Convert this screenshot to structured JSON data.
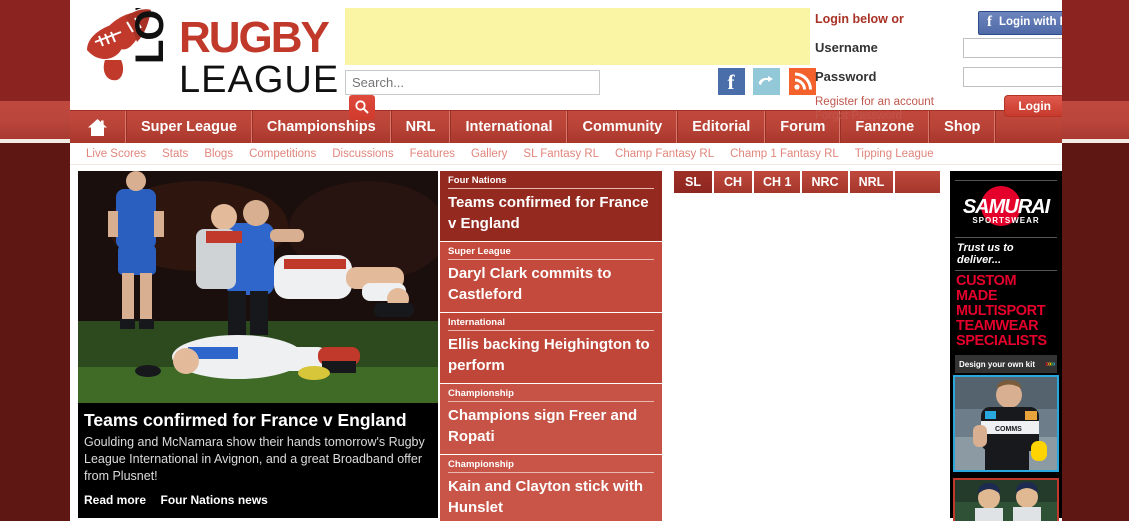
{
  "site": {
    "name": "Love Rugby League",
    "logo_line1": "LOVE",
    "logo_line2": "RUGBY",
    "logo_line3": "LEAGUE"
  },
  "search": {
    "placeholder": "Search...",
    "value": "",
    "icon": "search-icon"
  },
  "social": [
    {
      "name": "facebook-icon",
      "label": "f"
    },
    {
      "name": "twitter-icon",
      "label": "t"
    },
    {
      "name": "rss-icon",
      "label": "rss"
    }
  ],
  "login": {
    "title": "Login below or",
    "facebook_button": "Login with Facebook",
    "username_label": "Username",
    "username_value": "",
    "password_label": "Password",
    "password_value": "",
    "register_link": "Register for an account",
    "forgot_link": "Forgot Password",
    "submit_label": "Login"
  },
  "nav": {
    "home_icon": "home-icon",
    "items": [
      {
        "label": "Super League"
      },
      {
        "label": "Championships"
      },
      {
        "label": "NRL"
      },
      {
        "label": "International"
      },
      {
        "label": "Community"
      },
      {
        "label": "Editorial"
      },
      {
        "label": "Forum"
      },
      {
        "label": "Fanzone"
      },
      {
        "label": "Shop"
      }
    ]
  },
  "subnav": [
    {
      "label": "Live Scores"
    },
    {
      "label": "Stats"
    },
    {
      "label": "Blogs"
    },
    {
      "label": "Competitions"
    },
    {
      "label": "Discussions"
    },
    {
      "label": "Features"
    },
    {
      "label": "Gallery"
    },
    {
      "label": "SL Fantasy RL"
    },
    {
      "label": "Champ Fantasy RL"
    },
    {
      "label": "Champ 1 Fantasy RL"
    },
    {
      "label": "Tipping League"
    }
  ],
  "feature": {
    "headline": "Teams confirmed for France v England",
    "summary": "Goulding and McNamara show their hands tomorrow's Rugby League International in Avignon, and a great Broadband offer from Plusnet!",
    "read_more": "Read more",
    "section_link": "Four Nations news",
    "image_alt": "rugby-league-tackle-photo"
  },
  "newslist": [
    {
      "category": "Four Nations",
      "headline": "Teams confirmed for France v England",
      "bg": "#93291f"
    },
    {
      "category": "Super League",
      "headline": "Daryl Clark commits to Castleford",
      "bg": "#c34a3d"
    },
    {
      "category": "International",
      "headline": "Ellis backing Heighington to perform",
      "bg": "#bf4639"
    },
    {
      "category": "Championship",
      "headline": "Champions sign Freer and Ropati",
      "bg": "#c75346"
    },
    {
      "category": "Championship",
      "headline": "Kain and Clayton stick with Hunslet",
      "bg": "#c95548"
    }
  ],
  "tabs": [
    {
      "label": "SL",
      "active": true
    },
    {
      "label": "CH",
      "active": false
    },
    {
      "label": "CH 1",
      "active": false
    },
    {
      "label": "NRC",
      "active": false
    },
    {
      "label": "NRL",
      "active": false
    }
  ],
  "ads": {
    "samurai": {
      "brand": "SAMURAI",
      "brand_sub": "SPORTSWEAR",
      "tagline": "Trust us to deliver...",
      "headline": "CUSTOM MADE MULTISPORT TEAMWEAR SPECIALISTS",
      "button": "Design your own kit"
    },
    "photo1_alt": "rugby-player-advert-photo",
    "photo2_alt": "cricket-players-advert-photo"
  },
  "colors": {
    "brand_red": "#b94337",
    "dark_red": "#8b2420",
    "accent_red": "#c63a2c",
    "banner_yellow": "#faf4a5",
    "facebook_blue": "#4a6ea9",
    "link_pink": "#e0867c"
  }
}
